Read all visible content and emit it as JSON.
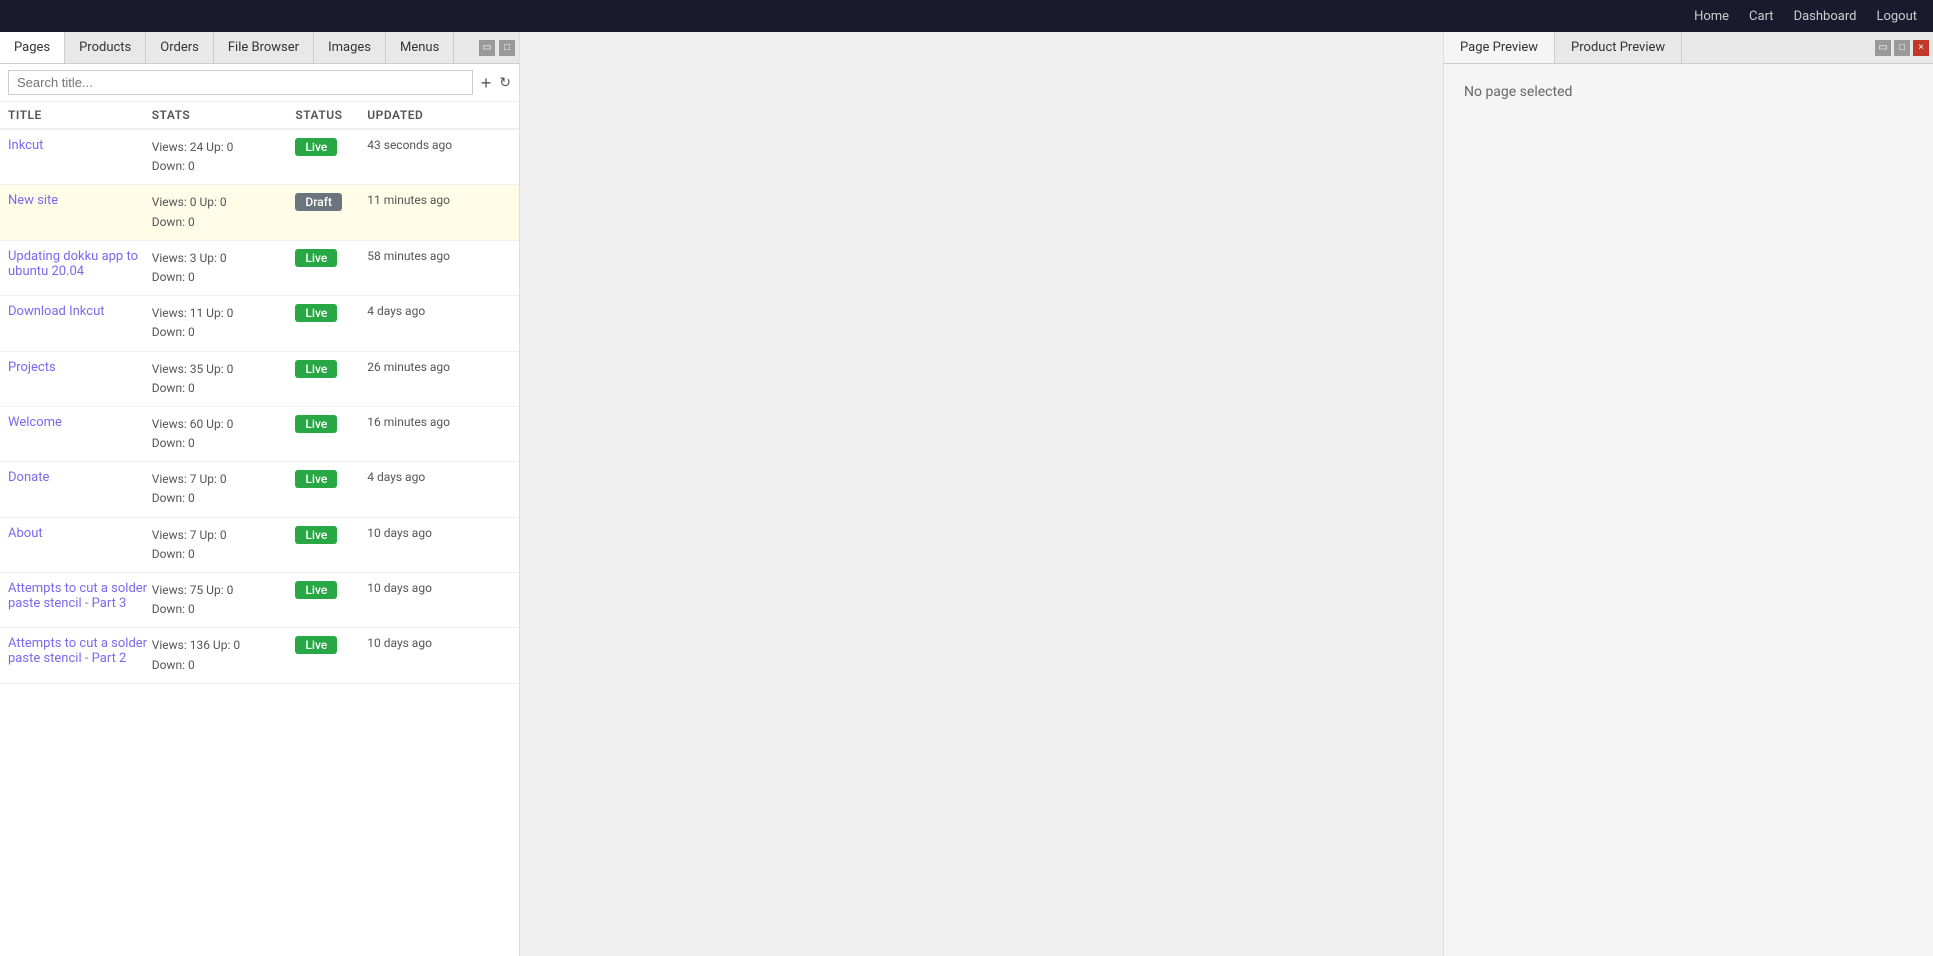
{
  "topNav": {
    "links": [
      "Home",
      "Cart",
      "Dashboard",
      "Logout"
    ]
  },
  "leftPanel": {
    "tabs": [
      {
        "label": "Pages",
        "active": true
      },
      {
        "label": "Products",
        "active": false
      },
      {
        "label": "Orders",
        "active": false
      },
      {
        "label": "File Browser",
        "active": false
      },
      {
        "label": "Images",
        "active": false
      },
      {
        "label": "Menus",
        "active": false
      }
    ],
    "search": {
      "placeholder": "Search title..."
    },
    "table": {
      "headers": [
        "TITLE",
        "STATS",
        "STATUS",
        "UPDATED"
      ],
      "rows": [
        {
          "title": "Inkcut",
          "stats_views": "Views: 24",
          "stats_up": "Up: 0",
          "stats_down": "Down: 0",
          "status": "Live",
          "status_type": "live",
          "updated": "43 seconds ago",
          "highlighted": false
        },
        {
          "title": "New site",
          "stats_views": "Views: 0",
          "stats_up": "Up: 0",
          "stats_down": "Down: 0",
          "status": "Draft",
          "status_type": "draft",
          "updated": "11 minutes ago",
          "highlighted": true
        },
        {
          "title": "Updating dokku app to ubuntu 20.04",
          "stats_views": "Views: 3",
          "stats_up": "Up: 0",
          "stats_down": "Down: 0",
          "status": "Live",
          "status_type": "live",
          "updated": "58 minutes ago",
          "highlighted": false
        },
        {
          "title": "Download Inkcut",
          "stats_views": "Views: 11",
          "stats_up": "Up: 0",
          "stats_down": "Down: 0",
          "status": "Live",
          "status_type": "live",
          "updated": "4 days ago",
          "highlighted": false
        },
        {
          "title": "Projects",
          "stats_views": "Views: 35",
          "stats_up": "Up: 0",
          "stats_down": "Down: 0",
          "status": "Live",
          "status_type": "live",
          "updated": "26 minutes ago",
          "highlighted": false
        },
        {
          "title": "Welcome",
          "stats_views": "Views: 60",
          "stats_up": "Up: 0",
          "stats_down": "Down: 0",
          "status": "Live",
          "status_type": "live",
          "updated": "16 minutes ago",
          "highlighted": false
        },
        {
          "title": "Donate",
          "stats_views": "Views: 7",
          "stats_up": "Up: 0",
          "stats_down": "Down: 0",
          "status": "Live",
          "status_type": "live",
          "updated": "4 days ago",
          "highlighted": false
        },
        {
          "title": "About",
          "stats_views": "Views: 7",
          "stats_up": "Up: 0",
          "stats_down": "Down: 0",
          "status": "Live",
          "status_type": "live",
          "updated": "10 days ago",
          "highlighted": false
        },
        {
          "title": "Attempts to cut a solder paste stencil - Part 3",
          "stats_views": "Views: 75",
          "stats_up": "Up: 0",
          "stats_down": "Down: 0",
          "status": "Live",
          "status_type": "live",
          "updated": "10 days ago",
          "highlighted": false
        },
        {
          "title": "Attempts to cut a solder paste stencil - Part 2",
          "stats_views": "Views: 136",
          "stats_up": "Up: 0",
          "stats_down": "Down: 0",
          "status": "Live",
          "status_type": "live",
          "updated": "10 days ago",
          "highlighted": false
        }
      ]
    }
  },
  "rightPanel": {
    "tabs": [
      {
        "label": "Page Preview",
        "active": true
      },
      {
        "label": "Product Preview",
        "active": false
      }
    ],
    "content": {
      "noPageMsg": "No page selected"
    }
  },
  "controls": {
    "add": "+",
    "refresh": "↻",
    "minimize": "▭",
    "maximize": "□",
    "close": "×"
  }
}
